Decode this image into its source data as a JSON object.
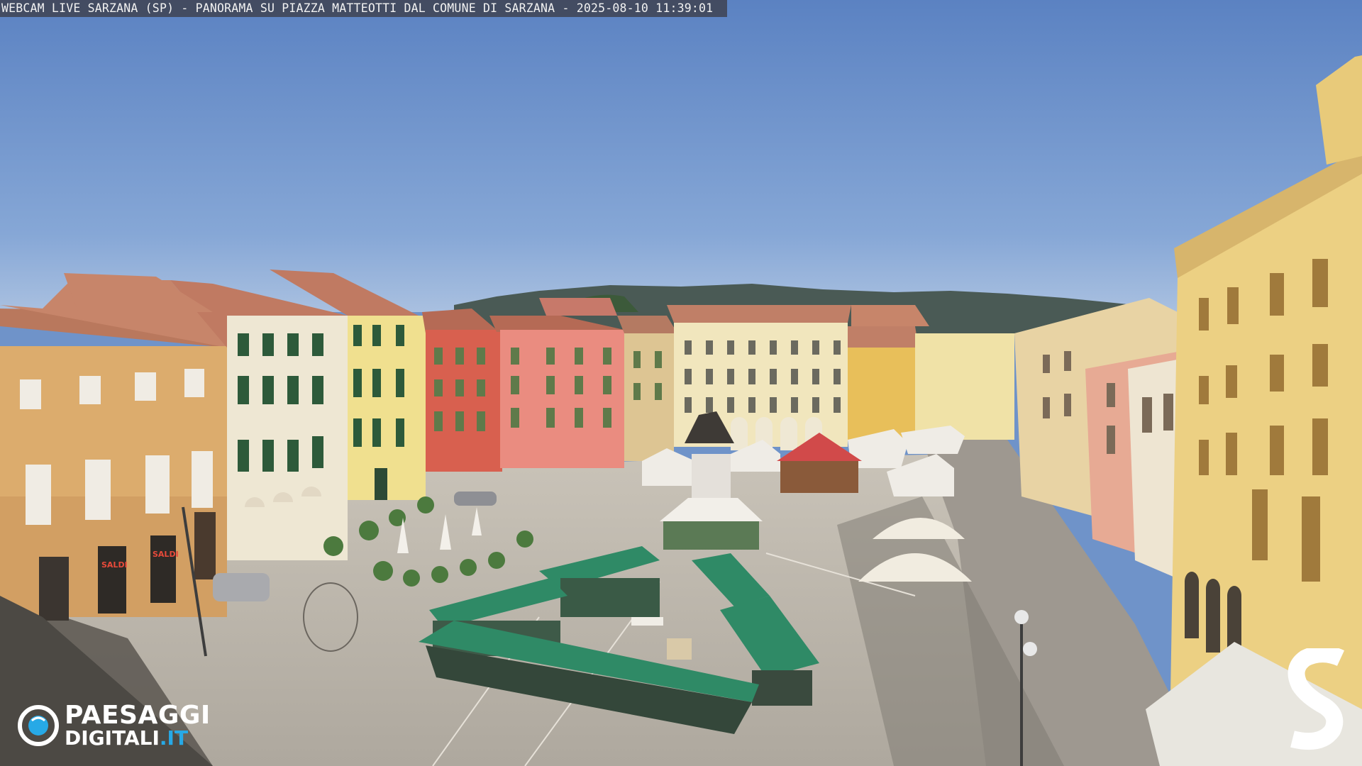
{
  "caption": "WEBCAM LIVE SARZANA (SP) - PANORAMA SU PIAZZA MATTEOTTI DAL COMUNE DI SARZANA - 2025-08-10  11:39:01",
  "logo": {
    "line1": "PAESAGGI",
    "line2_main": "DIGITALI",
    "line2_suffix": ".IT",
    "accent_color": "#27a9e6",
    "icon": "eye-camera-icon"
  },
  "brand_mark": {
    "icon": "stylized-s-icon"
  },
  "shop_signs": [
    "SALDI",
    "SALDI"
  ]
}
